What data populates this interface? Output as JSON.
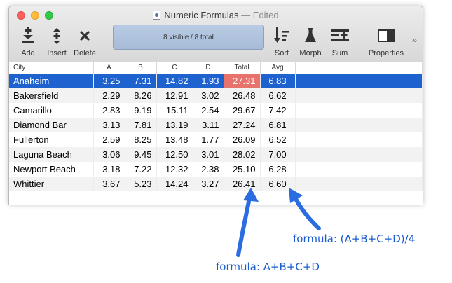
{
  "window": {
    "title": "Numeric Formulas",
    "edited": "— Edited"
  },
  "toolbar": {
    "add": "Add",
    "insert": "Insert",
    "delete": "Delete",
    "status": "8 visible / 8 total",
    "sort": "Sort",
    "morph": "Morph",
    "sum": "Sum",
    "properties": "Properties",
    "more": "»"
  },
  "table": {
    "headers": [
      "City",
      "A",
      "B",
      "C",
      "D",
      "Total",
      "Avg"
    ],
    "rows": [
      [
        "Anaheim",
        "3.25",
        "7.31",
        "14.82",
        "1.93",
        "27.31",
        "6.83"
      ],
      [
        "Bakersfield",
        "2.29",
        "8.26",
        "12.91",
        "3.02",
        "26.48",
        "6.62"
      ],
      [
        "Camarillo",
        "2.83",
        "9.19",
        "15.11",
        "2.54",
        "29.67",
        "7.42"
      ],
      [
        "Diamond Bar",
        "3.13",
        "7.81",
        "13.19",
        "3.11",
        "27.24",
        "6.81"
      ],
      [
        "Fullerton",
        "2.59",
        "8.25",
        "13.48",
        "1.77",
        "26.09",
        "6.52"
      ],
      [
        "Laguna Beach",
        "3.06",
        "9.45",
        "12.50",
        "3.01",
        "28.02",
        "7.00"
      ],
      [
        "Newport Beach",
        "3.18",
        "7.22",
        "12.32",
        "2.38",
        "25.10",
        "6.28"
      ],
      [
        "Whittier",
        "3.67",
        "5.23",
        "14.24",
        "3.27",
        "26.41",
        "6.60"
      ]
    ]
  },
  "annotations": {
    "avg_formula": "formula: (A+B+C+D)/4",
    "total_formula": "formula: A+B+C+D"
  },
  "colors": {
    "selection": "#1e62d0",
    "highlight_cell": "#e8736d",
    "annotation": "#1b5ccf"
  }
}
